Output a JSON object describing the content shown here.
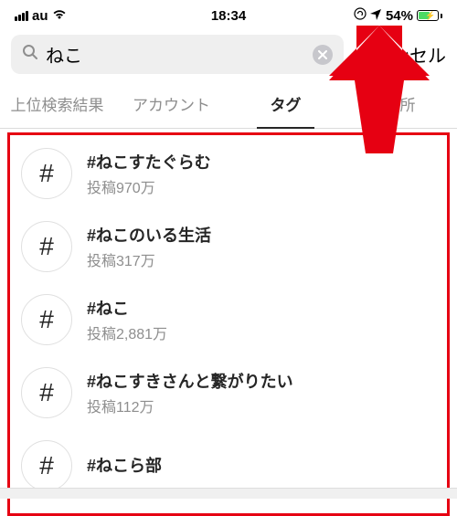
{
  "status": {
    "carrier": "au",
    "time": "18:34",
    "battery_pct": "54%",
    "rotation_lock": "⊕"
  },
  "search": {
    "value": "ねこ",
    "cancel": "キャンセル"
  },
  "tabs": {
    "top": "上位検索結果",
    "accounts": "アカウント",
    "tags": "タグ",
    "places": "場所"
  },
  "results": [
    {
      "tag": "#ねこすたぐらむ",
      "count": "投稿970万"
    },
    {
      "tag": "#ねこのいる生活",
      "count": "投稿317万"
    },
    {
      "tag": "#ねこ",
      "count": "投稿2,881万"
    },
    {
      "tag": "#ねこすきさんと繋がりたい",
      "count": "投稿112万"
    },
    {
      "tag": "#ねこら部",
      "count": ""
    }
  ]
}
